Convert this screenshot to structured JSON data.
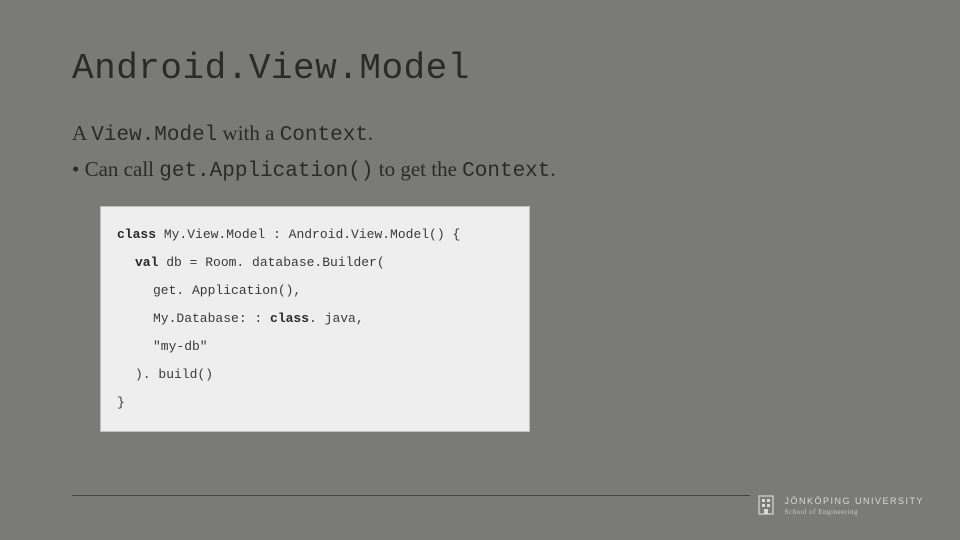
{
  "title": "Android.View.Model",
  "line1": {
    "prefix": "A ",
    "code1": "View.Model",
    "mid": " with a ",
    "code2": "Context",
    "suffix": "."
  },
  "line2": {
    "bullet": "• Can call ",
    "code1": "get.Application()",
    "mid": " to get the ",
    "code2": "Context",
    "suffix": "."
  },
  "code": {
    "l1_kw": "class",
    "l1_rest": " My.View.Model : Android.View.Model() {",
    "l2_kw": "val",
    "l2_rest": " db = Room. database.Builder(",
    "l3": "get. Application(),",
    "l4_pre": "My.Database: : ",
    "l4_kw": "class",
    "l4_post": ". java,",
    "l5": "\"my-db\"",
    "l6": "). build()",
    "l7": "}"
  },
  "footer": {
    "university": "JÖNKÖPING UNIVERSITY",
    "school": "School of Engineering"
  }
}
